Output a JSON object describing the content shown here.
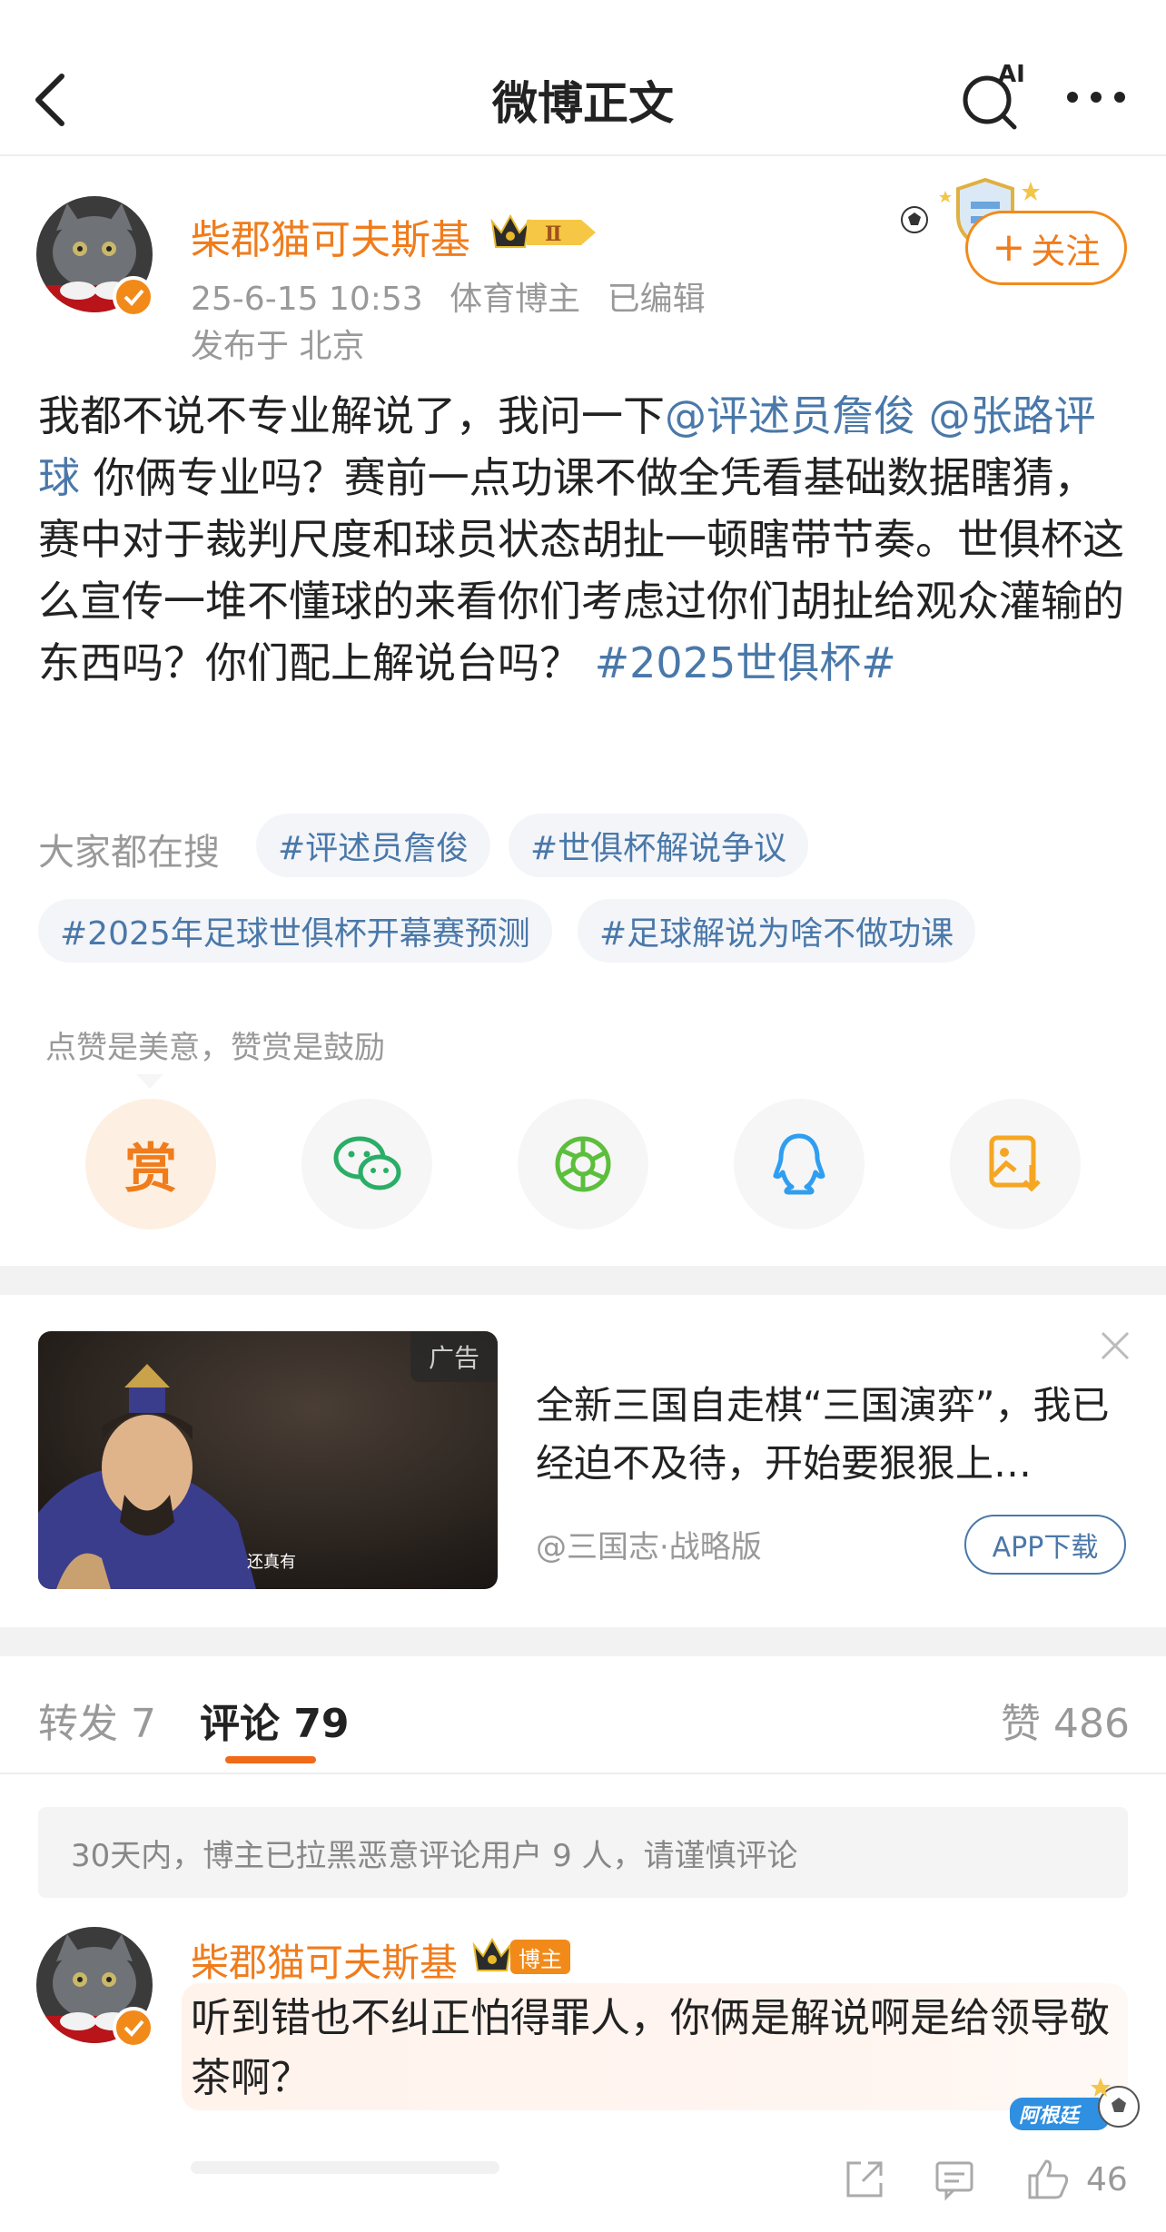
{
  "header": {
    "title": "微博正文",
    "ai_badge": "AI"
  },
  "author": {
    "name": "柴郡猫可夫斯基",
    "vip_level": "Ⅱ",
    "date": "25-6-15 10:53",
    "role": "体育博主",
    "edited": "已编辑",
    "location": "发布于 北京",
    "follow_label": "关注"
  },
  "post": {
    "t1": "我都不说不专业解说了，我问一下",
    "mention1": "@评述员詹俊",
    "mention2": "@张路评球",
    "t2": " 你俩专业吗？赛前一点功课不做全凭看基础数据瞎猜，赛中对于裁判尺度和球员状态胡扯一顿瞎带节奏。世俱杯这么宣传一堆不懂球的来看你们考虑过你们胡扯给观众灌输的东西吗？你们配上解说台吗？ ",
    "hashtag": "#2025世俱杯#"
  },
  "trending": {
    "label": "大家都在搜",
    "chips": [
      "#评述员詹俊",
      "#世俱杯解说争议",
      "#2025年足球世俱杯开幕赛预测",
      "#足球解说为啥不做功课"
    ]
  },
  "reward": {
    "caption": "点赞是美意，赞赏是鼓励",
    "button": "赏"
  },
  "ad": {
    "tag": "广告",
    "caption": "还真有",
    "title": "全新三国自走棋“三国演弈”，我已经迫不及待，开始要狠狠上…",
    "source": "@三国志·战略版",
    "download": "APP下载"
  },
  "tabs": {
    "repost": "转发 7",
    "comment": "评论 79",
    "like": "赞 486"
  },
  "notice": "30天内，博主已拉黑恶意评论用户 9 人，请谨慎评论",
  "comment": {
    "name": "柴郡猫可夫斯基",
    "tag": "博主",
    "text": "听到错也不纠正怕得罪人，你俩是解说啊是给领导敬茶啊？",
    "sticker": "阿根廷",
    "likes": "46"
  },
  "colors": {
    "accent": "#f07c1c",
    "link": "#4a78a9",
    "wechat": "#2aae67",
    "moments": "#5cbf3c",
    "qq": "#2f9ef0",
    "save": "#f5a623"
  }
}
